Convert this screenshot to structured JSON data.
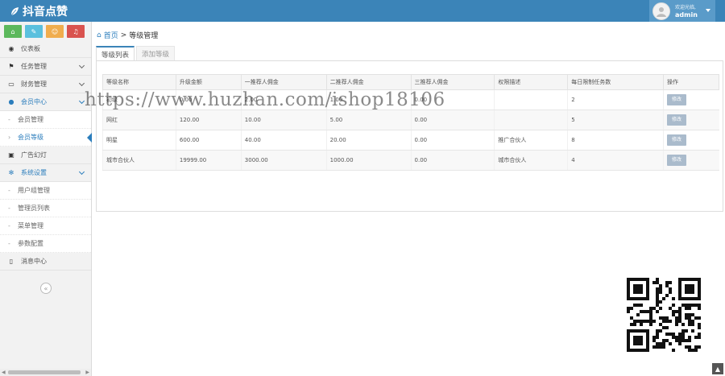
{
  "header": {
    "brand": "抖音点赞",
    "welcome": "欢迎光临,",
    "username": "admin"
  },
  "sidebar": {
    "shortcuts": [
      {
        "icon": "home-icon",
        "color": "#5cb85c",
        "glyph": "⌂"
      },
      {
        "icon": "pencil-icon",
        "color": "#5bc0de",
        "glyph": "✎"
      },
      {
        "icon": "users-icon",
        "color": "#f0ad4e",
        "glyph": "☺"
      },
      {
        "icon": "bell-icon",
        "color": "#d9534f",
        "glyph": "♫"
      }
    ],
    "items": [
      {
        "label": "仪表板",
        "icon": "dashboard-icon",
        "glyph": "◉",
        "chevron": false
      },
      {
        "label": "任务管理",
        "icon": "flag-icon",
        "glyph": "⚑",
        "chevron": true
      },
      {
        "label": "财务管理",
        "icon": "inbox-icon",
        "glyph": "▭",
        "chevron": true
      },
      {
        "label": "会员中心",
        "icon": "user-icon",
        "glyph": "●",
        "chevron": true,
        "open": true,
        "children": [
          {
            "label": "会员管理"
          },
          {
            "label": "会员等级",
            "active": true
          }
        ]
      },
      {
        "label": "广告幻灯",
        "icon": "image-icon",
        "glyph": "▣",
        "chevron": false
      },
      {
        "label": "系统设置",
        "icon": "gear-icon",
        "glyph": "✻",
        "chevron": true,
        "open": true,
        "children": [
          {
            "label": "用户组管理"
          },
          {
            "label": "管理员列表"
          },
          {
            "label": "菜单管理"
          },
          {
            "label": "参数配置"
          }
        ]
      },
      {
        "label": "消息中心",
        "icon": "bookmark-icon",
        "glyph": "▯",
        "chevron": false
      }
    ],
    "collapse_glyph": "«"
  },
  "main": {
    "breadcrumb": {
      "home": "首页",
      "sep": ">",
      "current": "等级管理"
    },
    "tabs": [
      "等级列表",
      "添加等级"
    ],
    "table": {
      "headers": [
        "等级名称",
        "升级金额",
        "一推荐人佣金",
        "二推荐人佣金",
        "三推荐人佣金",
        "权限描述",
        "每日限制任务数",
        "操作"
      ],
      "rows": [
        [
          "初级",
          "0.00",
          "2.00",
          "1.00",
          "0.00",
          "",
          "2",
          "修改"
        ],
        [
          "网红",
          "120.00",
          "10.00",
          "5.00",
          "0.00",
          "",
          "5",
          "修改"
        ],
        [
          "明星",
          "600.00",
          "40.00",
          "20.00",
          "0.00",
          "推广合伙人",
          "8",
          "修改"
        ],
        [
          "城市合伙人",
          "19999.00",
          "3000.00",
          "1000.00",
          "0.00",
          "城市合伙人",
          "4",
          "修改"
        ]
      ]
    }
  },
  "watermark": "https://www.huzhan.com/ishop18106",
  "to_top_glyph": "▲"
}
